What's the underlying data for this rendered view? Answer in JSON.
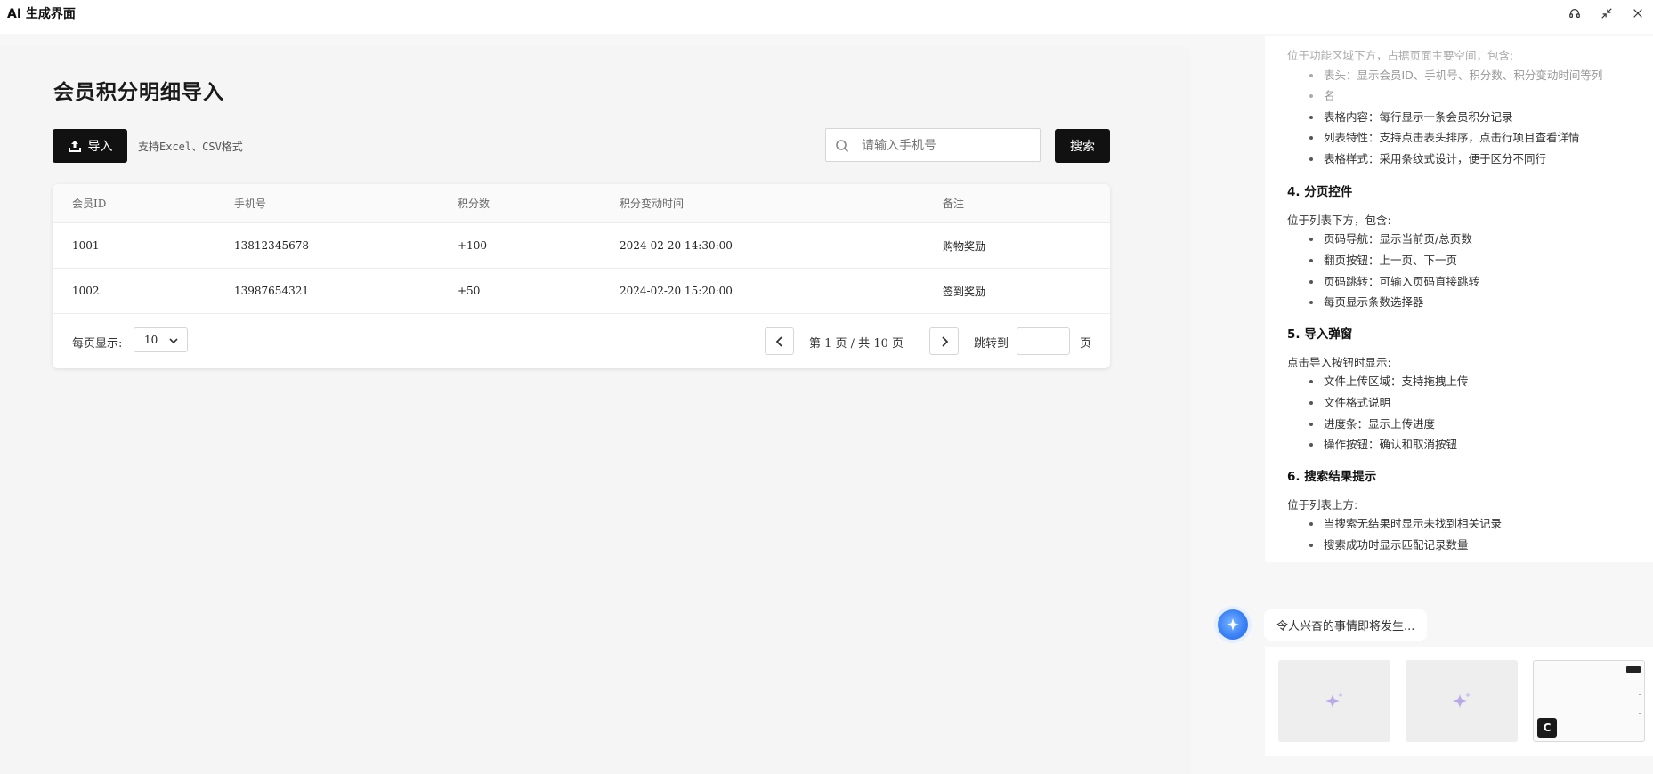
{
  "window": {
    "title": "AI 生成界面",
    "controls": [
      "headset-icon",
      "collapse-icon",
      "close-icon"
    ]
  },
  "page": {
    "title": "会员积分明细导入",
    "import_label": "导入",
    "import_hint": "支持Excel、CSV格式",
    "search_placeholder": "请输入手机号",
    "search_label": "搜索"
  },
  "table": {
    "columns": [
      "会员ID",
      "手机号",
      "积分数",
      "积分变动时间",
      "备注"
    ],
    "rows": [
      [
        "1001",
        "13812345678",
        "+100",
        "2024-02-20 14:30:00",
        "购物奖励"
      ],
      [
        "1002",
        "13987654321",
        "+50",
        "2024-02-20 15:20:00",
        "签到奖励"
      ]
    ]
  },
  "pagination": {
    "per_page_label": "每页显示:",
    "per_page_value": "10",
    "page_info": "第 1 页 / 共 10 页",
    "jump_label": "跳转到",
    "jump_suffix": "页"
  },
  "doc": {
    "intro_partial": "位于功能区域下方，占据页面主要空间，包含:",
    "list_items": [
      "表头：显示会员ID、手机号、积分数、积分变动时间等列",
      "名",
      "表格内容：每行显示一条会员积分记录",
      "列表特性：支持点击表头排序，点击行项目查看详情",
      "表格样式：采用条纹式设计，便于区分不同行"
    ],
    "sections": [
      {
        "heading": "4. 分页控件",
        "intro": "位于列表下方，包含:",
        "items": [
          "页码导航：显示当前页/总页数",
          "翻页按钮：上一页、下一页",
          "页码跳转：可输入页码直接跳转",
          "每页显示条数选择器"
        ]
      },
      {
        "heading": "5. 导入弹窗",
        "intro": "点击导入按钮时显示:",
        "items": [
          "文件上传区域：支持拖拽上传",
          "文件格式说明",
          "进度条：显示上传进度",
          "操作按钮：确认和取消按钮"
        ]
      },
      {
        "heading": "6. 搜索结果提示",
        "intro": "位于列表上方:",
        "items": [
          "当搜索无结果时显示未找到相关记录",
          "搜索成功时显示匹配记录数量"
        ]
      }
    ]
  },
  "assistant": {
    "status": "令人兴奋的事情即将发生...",
    "badge": "C"
  },
  "colors": {
    "primary_button": "#111111",
    "canvas_bg": "#f5f5f6",
    "accent_blue": "#3b82f6",
    "sparkle": "#b8a8e8"
  }
}
